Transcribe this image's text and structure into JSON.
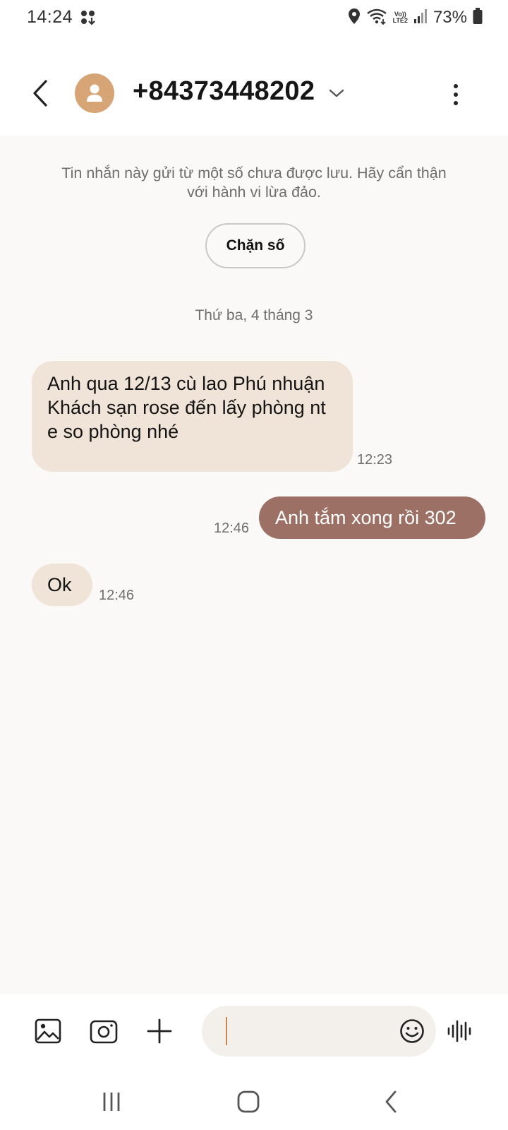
{
  "status_bar": {
    "time": "14:24",
    "battery": "73%",
    "lte_top": "Vo))",
    "lte_bottom": "LTE2",
    "icons": [
      "app-notification-icon",
      "location-icon",
      "wifi-icon",
      "lte-icon",
      "signal-icon",
      "battery-icon"
    ]
  },
  "header": {
    "contact_number": "+84373448202",
    "icons": [
      "back-arrow-icon",
      "contact-avatar",
      "chevron-down-icon",
      "more-options-icon"
    ]
  },
  "warning": {
    "text": "Tin nhắn này gửi từ một số chưa được lưu. Hãy cẩn thận với hành vi lừa đảo.",
    "block_label": "Chặn số"
  },
  "conversation": {
    "date": "Thứ ba, 4 tháng 3",
    "messages": [
      {
        "direction": "incoming",
        "text": "Anh qua 12/13 cù lao Phú nhuận\nKhách sạn rose đến lấy phòng nt e so phòng nhé",
        "time": "12:23"
      },
      {
        "direction": "outgoing",
        "text": "Anh tắm xong rồi 302",
        "time": "12:46"
      },
      {
        "direction": "incoming",
        "text": "Ok",
        "time": "12:46"
      }
    ]
  },
  "compose": {
    "icons": [
      "gallery-icon",
      "camera-icon",
      "plus-icon",
      "emoji-icon",
      "voice-icon"
    ],
    "input_value": ""
  },
  "nav_bar": {
    "icons": [
      "recent-apps-icon",
      "home-icon",
      "back-icon"
    ]
  },
  "colors": {
    "incoming_bubble": "#f0e3d7",
    "outgoing_bubble": "#9c7064",
    "avatar": "#d7a575",
    "background": "#faf9f7"
  }
}
